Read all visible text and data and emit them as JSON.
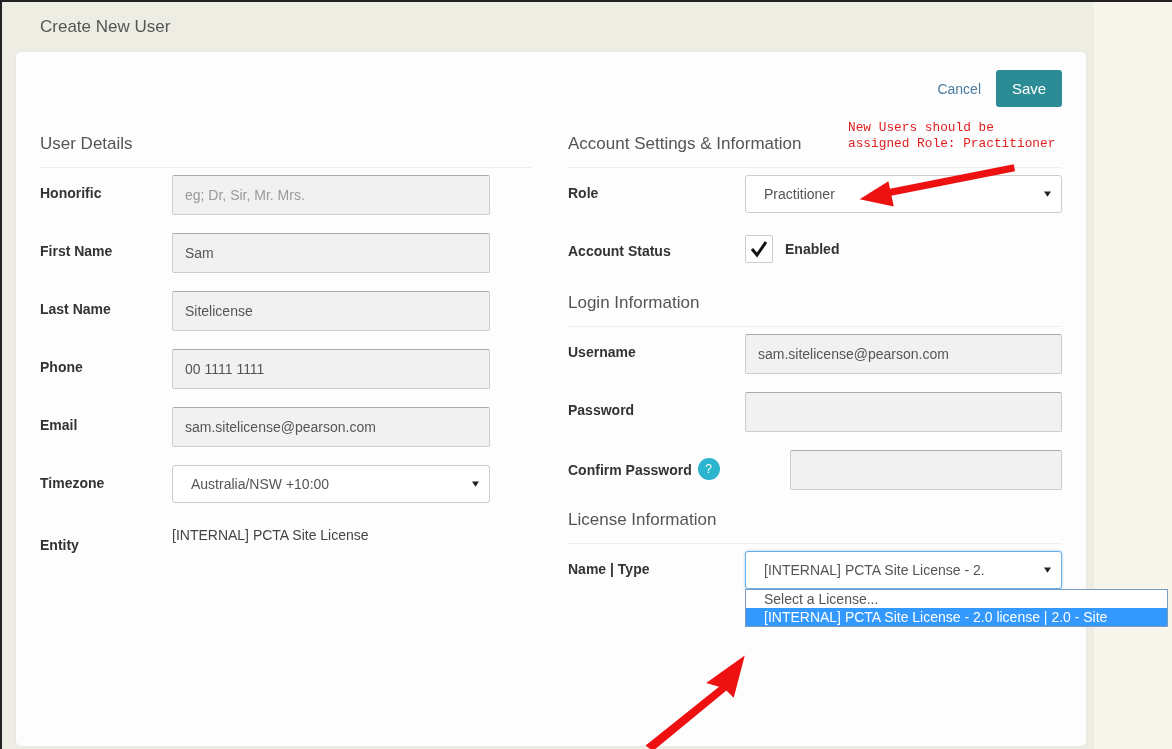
{
  "header": {
    "title": "Create New User"
  },
  "actions": {
    "cancel": "Cancel",
    "save": "Save"
  },
  "annotation": {
    "lines": [
      "New Users should be",
      "assigned Role: Practitioner"
    ]
  },
  "user_details": {
    "heading": "User Details",
    "fields": [
      {
        "label": "Honorific",
        "kind": "text",
        "placeholder": "eg; Dr, Sir, Mr. Mrs."
      },
      {
        "label": "First Name",
        "kind": "text",
        "value": "Sam"
      },
      {
        "label": "Last Name",
        "kind": "text",
        "value": "Sitelicense"
      },
      {
        "label": "Phone",
        "kind": "text",
        "value": "00 1111 1111"
      },
      {
        "label": "Email",
        "kind": "text",
        "value": "sam.sitelicense@pearson.com"
      },
      {
        "label": "Timezone",
        "kind": "select",
        "value": "Australia/NSW +10:00",
        "focused": false
      },
      {
        "label": "Entity",
        "kind": "static",
        "value": "[INTERNAL] PCTA Site License"
      }
    ]
  },
  "account_settings": {
    "heading": "Account Settings & Information",
    "fields": [
      {
        "label": "Role",
        "kind": "select",
        "value": "Practitioner",
        "focused": false
      },
      {
        "label": "Account Status",
        "kind": "checkbox",
        "checked": true,
        "text": "Enabled"
      }
    ]
  },
  "login_information": {
    "heading": "Login Information",
    "fields": [
      {
        "label": "Username",
        "kind": "text",
        "value": "sam.sitelicense@pearson.com"
      },
      {
        "label": "Password",
        "kind": "text"
      },
      {
        "label": "Confirm Password",
        "kind": "text",
        "help": "?"
      }
    ]
  },
  "license_information": {
    "heading": "License Information",
    "fields": [
      {
        "label": "Name | Type",
        "kind": "select",
        "value": "[INTERNAL] PCTA Site License - 2.",
        "focused": true,
        "options": [
          {
            "label": "Select a License...",
            "selected": false
          },
          {
            "label": "[INTERNAL] PCTA Site License - 2.0 license | 2.0 - Site",
            "selected": true
          }
        ]
      }
    ]
  }
}
